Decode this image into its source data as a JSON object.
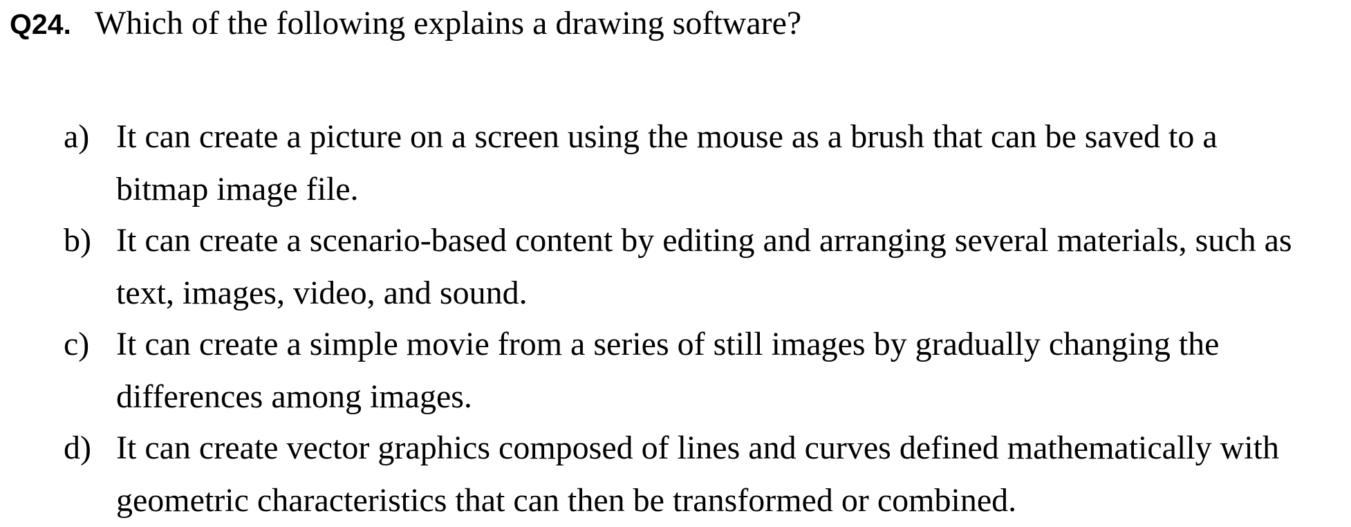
{
  "question": {
    "number": "Q24.",
    "text": "Which of the following explains a drawing software?"
  },
  "options": [
    {
      "letter": "a)",
      "lines": [
        "It can create a picture on a screen using the mouse as a brush that can be saved to a",
        "bitmap image file."
      ]
    },
    {
      "letter": "b)",
      "lines": [
        "It can create a scenario-based content by editing and arranging several materials, such as",
        "text, images, video, and sound."
      ]
    },
    {
      "letter": "c)",
      "lines": [
        "It can create a simple movie from a series of still images by gradually changing the",
        "differences among images."
      ]
    },
    {
      "letter": "d)",
      "lines": [
        "It can create vector graphics composed of lines and curves defined mathematically with",
        "geometric characteristics that can then be transformed or combined."
      ]
    }
  ]
}
